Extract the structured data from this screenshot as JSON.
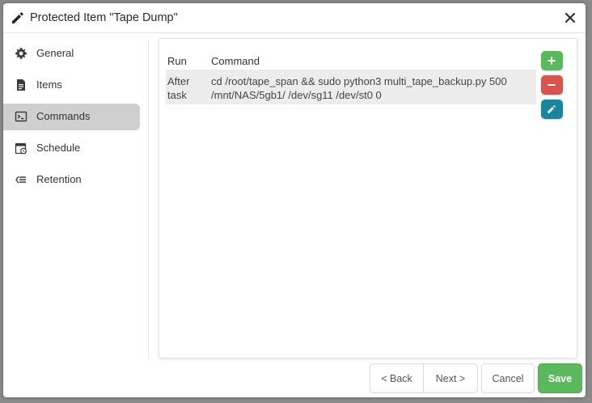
{
  "dialog": {
    "title": "Protected Item \"Tape Dump\"",
    "title_icon": "pencil-icon",
    "close_icon": "close-icon"
  },
  "sidebar": {
    "items": [
      {
        "label": "General",
        "icon": "gear-icon",
        "active": false
      },
      {
        "label": "Items",
        "icon": "document-icon",
        "active": false
      },
      {
        "label": "Commands",
        "icon": "terminal-icon",
        "active": true
      },
      {
        "label": "Schedule",
        "icon": "calendar-clock-icon",
        "active": false
      },
      {
        "label": "Retention",
        "icon": "retention-icon",
        "active": false
      }
    ]
  },
  "commands": {
    "columns": [
      "Run",
      "Command"
    ],
    "rows": [
      {
        "run_line1": "After",
        "run_line2": "task",
        "cmd_line1": "cd /root/tape_span && sudo python3 multi_tape_backup.py 500",
        "cmd_line2": "/mnt/NAS/5gb1/ /dev/sg11 /dev/st0 0"
      }
    ],
    "actions": [
      {
        "icon": "plus-icon",
        "color": "#5cb85c"
      },
      {
        "icon": "minus-icon",
        "color": "#d9534f"
      },
      {
        "icon": "pencil-icon",
        "color": "#17869e"
      }
    ]
  },
  "footer": {
    "back_label": "< Back",
    "next_label": "Next >",
    "cancel_label": "Cancel",
    "save_label": "Save",
    "save_color": "#5cb85c"
  }
}
